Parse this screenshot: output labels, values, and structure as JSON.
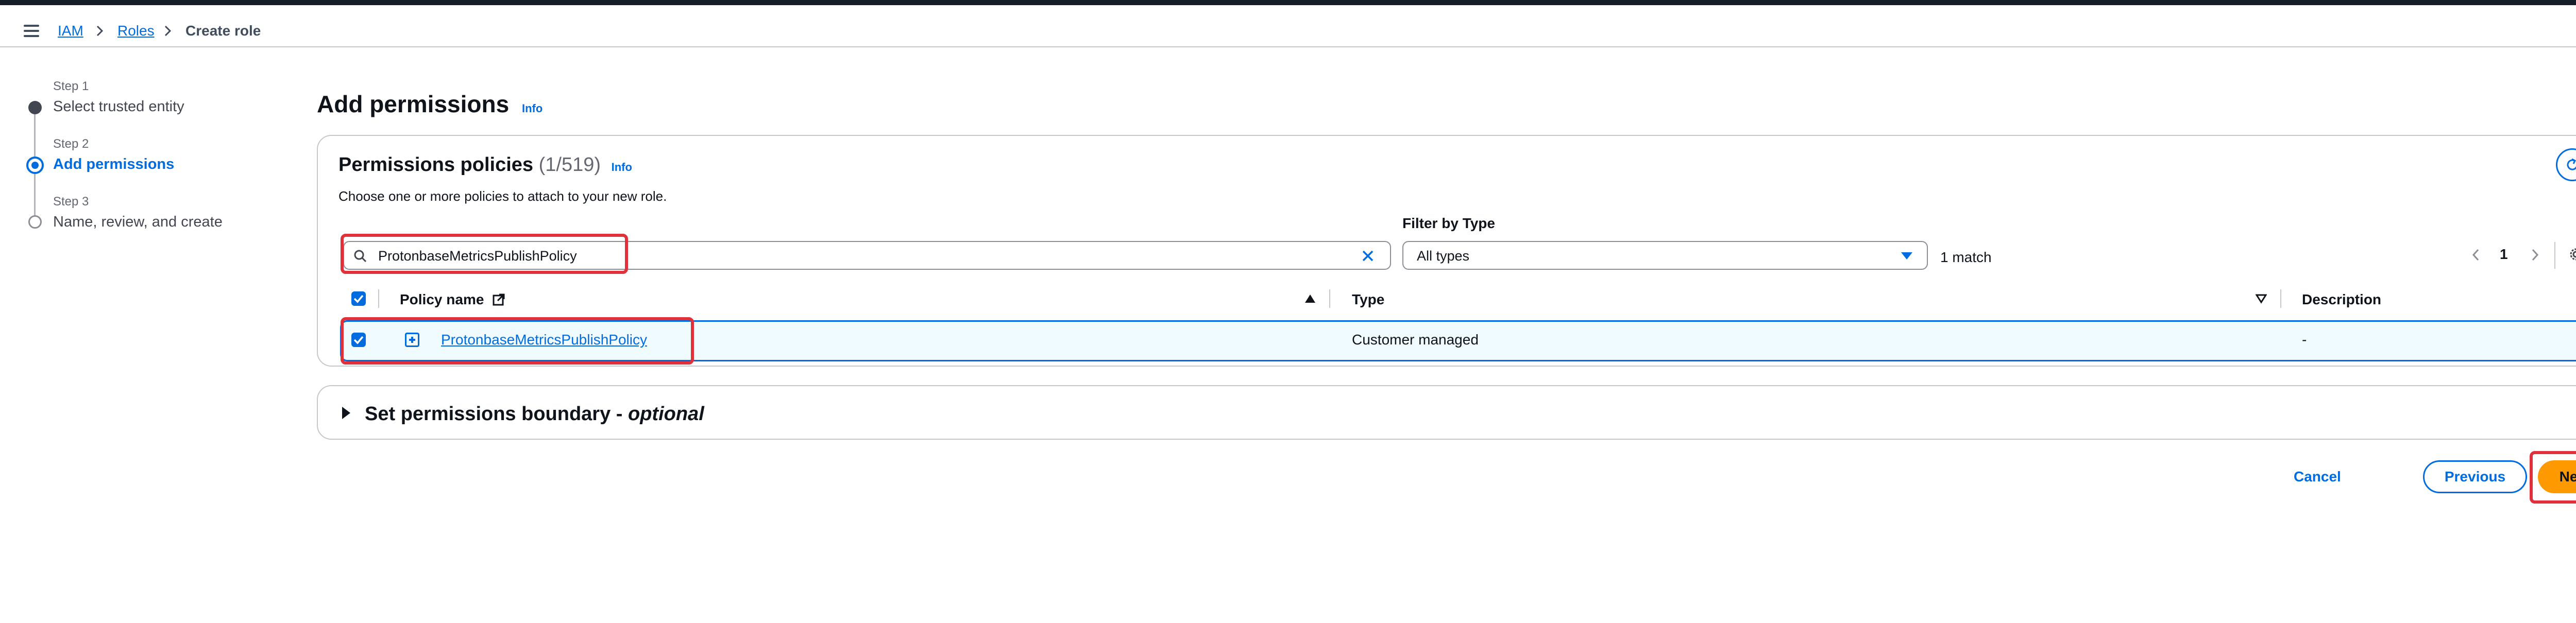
{
  "breadcrumb": {
    "iam": "IAM",
    "roles": "Roles",
    "current": "Create role"
  },
  "steps": [
    {
      "label": "Step 1",
      "title": "Select trusted entity"
    },
    {
      "label": "Step 2",
      "title": "Add permissions"
    },
    {
      "label": "Step 3",
      "title": "Name, review, and create"
    }
  ],
  "page": {
    "title": "Add permissions",
    "info": "Info"
  },
  "policies": {
    "title": "Permissions policies",
    "count": "(1/519)",
    "info": "Info",
    "description": "Choose one or more policies to attach to your new role.",
    "search_value": "ProtonbaseMetricsPublishPolicy",
    "filter_label": "Filter by Type",
    "filter_value": "All types",
    "match_text": "1 match",
    "page_number": "1",
    "columns": {
      "name": "Policy name",
      "type": "Type",
      "description": "Description"
    },
    "rows": [
      {
        "name": "ProtonbaseMetricsPublishPolicy",
        "type": "Customer managed",
        "description": "-"
      }
    ]
  },
  "boundary": {
    "title": "Set permissions boundary - ",
    "optional": "optional"
  },
  "actions": {
    "cancel": "Cancel",
    "previous": "Previous",
    "next": "Next"
  },
  "colors": {
    "accent": "#006ce0",
    "primary_button": "#ff9900",
    "highlight": "#e0313b"
  }
}
